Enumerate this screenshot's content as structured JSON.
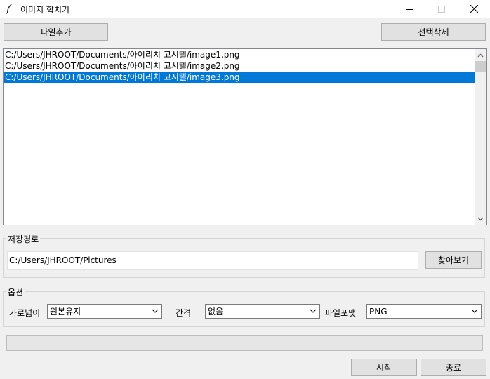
{
  "window": {
    "title": "이미지 합치기",
    "icon": "feather-icon",
    "controls": {
      "minimize": "minimize-icon",
      "maximize": "maximize-icon",
      "close": "close-icon"
    }
  },
  "toolbar": {
    "add_file_label": "파일추가",
    "delete_selected_label": "선택삭제"
  },
  "file_list": {
    "items": [
      {
        "path": "C:/Users/JHROOT/Documents/아이리치 고시텔/image1.png",
        "selected": false
      },
      {
        "path": "C:/Users/JHROOT/Documents/아이리치 고시텔/image2.png",
        "selected": false
      },
      {
        "path": "C:/Users/JHROOT/Documents/아이리치 고시텔/image3.png",
        "selected": true
      }
    ],
    "scrollbar": {
      "up_icon": "chevron-up-icon",
      "down_icon": "chevron-down-icon"
    },
    "selection_color": "#0078d7"
  },
  "save_path": {
    "group_label": "저장경로",
    "value": "C:/Users/JHROOT/Pictures",
    "browse_label": "찾아보기"
  },
  "options": {
    "group_label": "옵션",
    "width": {
      "label": "가로넓이",
      "value": "원본유지"
    },
    "spacing": {
      "label": "간격",
      "value": "없음"
    },
    "format": {
      "label": "파일포맷",
      "value": "PNG"
    }
  },
  "progress": {
    "value": 0
  },
  "footer": {
    "start_label": "시작",
    "exit_label": "종료"
  }
}
